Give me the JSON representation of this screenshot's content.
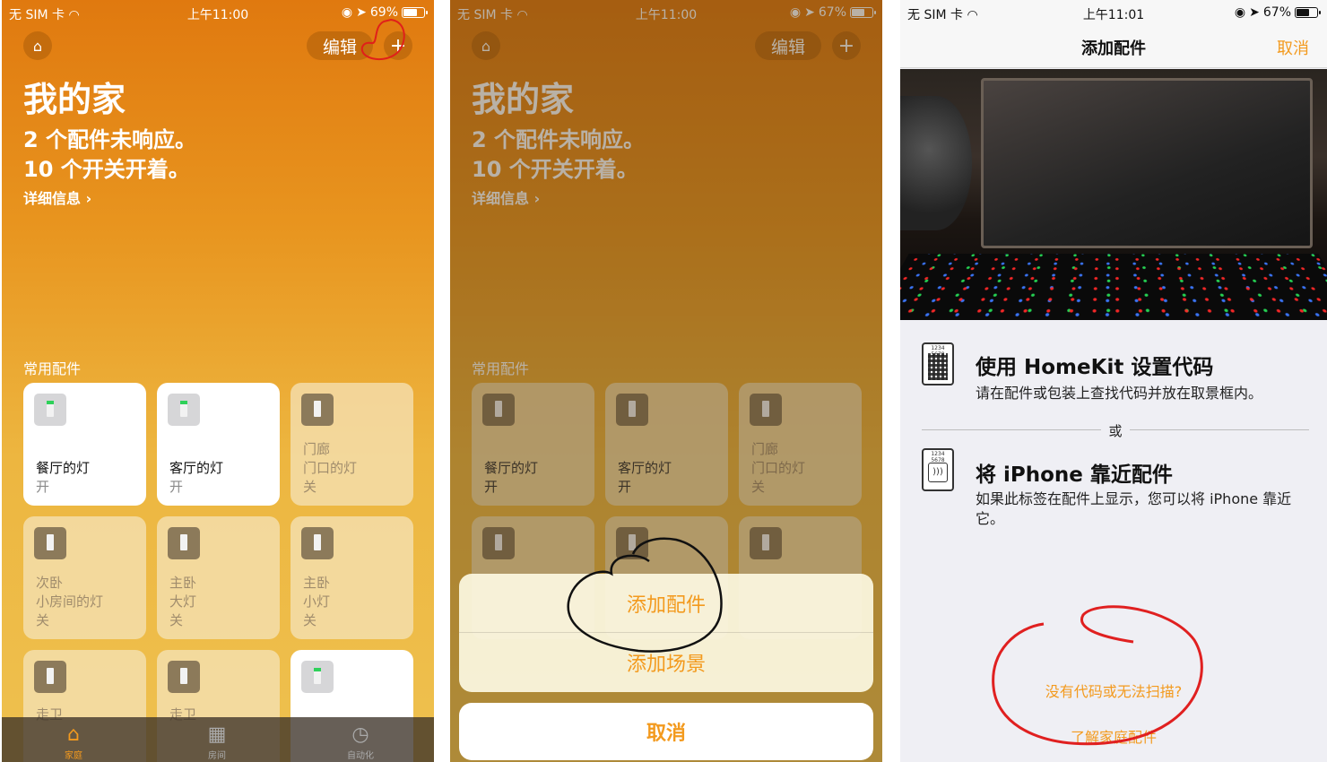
{
  "panel1": {
    "status": {
      "carrier": "无 SIM 卡",
      "time": "上午11:00",
      "battery": "69%",
      "battery_level": 0.69
    },
    "edit_label": "编辑",
    "title": "我的家",
    "summary_1": "2 个配件未响应。",
    "summary_2": "10 个开关开着。",
    "details_link": "详细信息 ›",
    "section": "常用配件",
    "tiles": [
      {
        "room": "",
        "name": "餐厅的灯",
        "state": "开"
      },
      {
        "room": "",
        "name": "客厅的灯",
        "state": "开"
      },
      {
        "room": "门廊",
        "name": "门口的灯",
        "state": "关"
      },
      {
        "room": "次卧",
        "name": "小房间的灯",
        "state": "关"
      },
      {
        "room": "主卧",
        "name": "大灯",
        "state": "关"
      },
      {
        "room": "主卧",
        "name": "小灯",
        "state": "关"
      },
      {
        "room": "",
        "name": "走卫",
        "state": ""
      },
      {
        "room": "",
        "name": "走卫",
        "state": ""
      },
      {
        "room": "",
        "name": "",
        "state": ""
      }
    ],
    "tabs": [
      {
        "label": "家庭",
        "icon": "house-icon"
      },
      {
        "label": "房间",
        "icon": "rooms-icon"
      },
      {
        "label": "自动化",
        "icon": "automation-icon"
      }
    ],
    "accent_color": "#f39a1e"
  },
  "panel2": {
    "status": {
      "carrier": "无 SIM 卡",
      "time": "上午11:00",
      "battery": "67%",
      "battery_level": 0.67
    },
    "edit_label": "编辑",
    "title": "我的家",
    "summary_1": "2 个配件未响应。",
    "summary_2": "10 个开关开着。",
    "details_link": "详细信息 ›",
    "section": "常用配件",
    "tiles": [
      {
        "room": "",
        "name": "餐厅的灯",
        "state": "开"
      },
      {
        "room": "",
        "name": "客厅的灯",
        "state": "开"
      },
      {
        "room": "门廊",
        "name": "门口的灯",
        "state": "关"
      }
    ],
    "action_sheet": {
      "add_accessory": "添加配件",
      "add_scene": "添加场景",
      "cancel": "取消"
    }
  },
  "panel3": {
    "status": {
      "carrier": "无 SIM 卡",
      "time": "上午11:01",
      "battery": "67%",
      "battery_level": 0.67
    },
    "nav_title": "添加配件",
    "nav_cancel": "取消",
    "code_badge": "1234 5678",
    "option1_title": "使用 HomeKit 设置代码",
    "option1_desc": "请在配件或包装上查找代码并放在取景框内。",
    "or": "或",
    "option2_title": "将 iPhone 靠近配件",
    "option2_desc": "如果此标签在配件上显示，您可以将 iPhone 靠近它。",
    "no_code_link": "没有代码或无法扫描?",
    "learn_link": "了解家庭配件"
  }
}
